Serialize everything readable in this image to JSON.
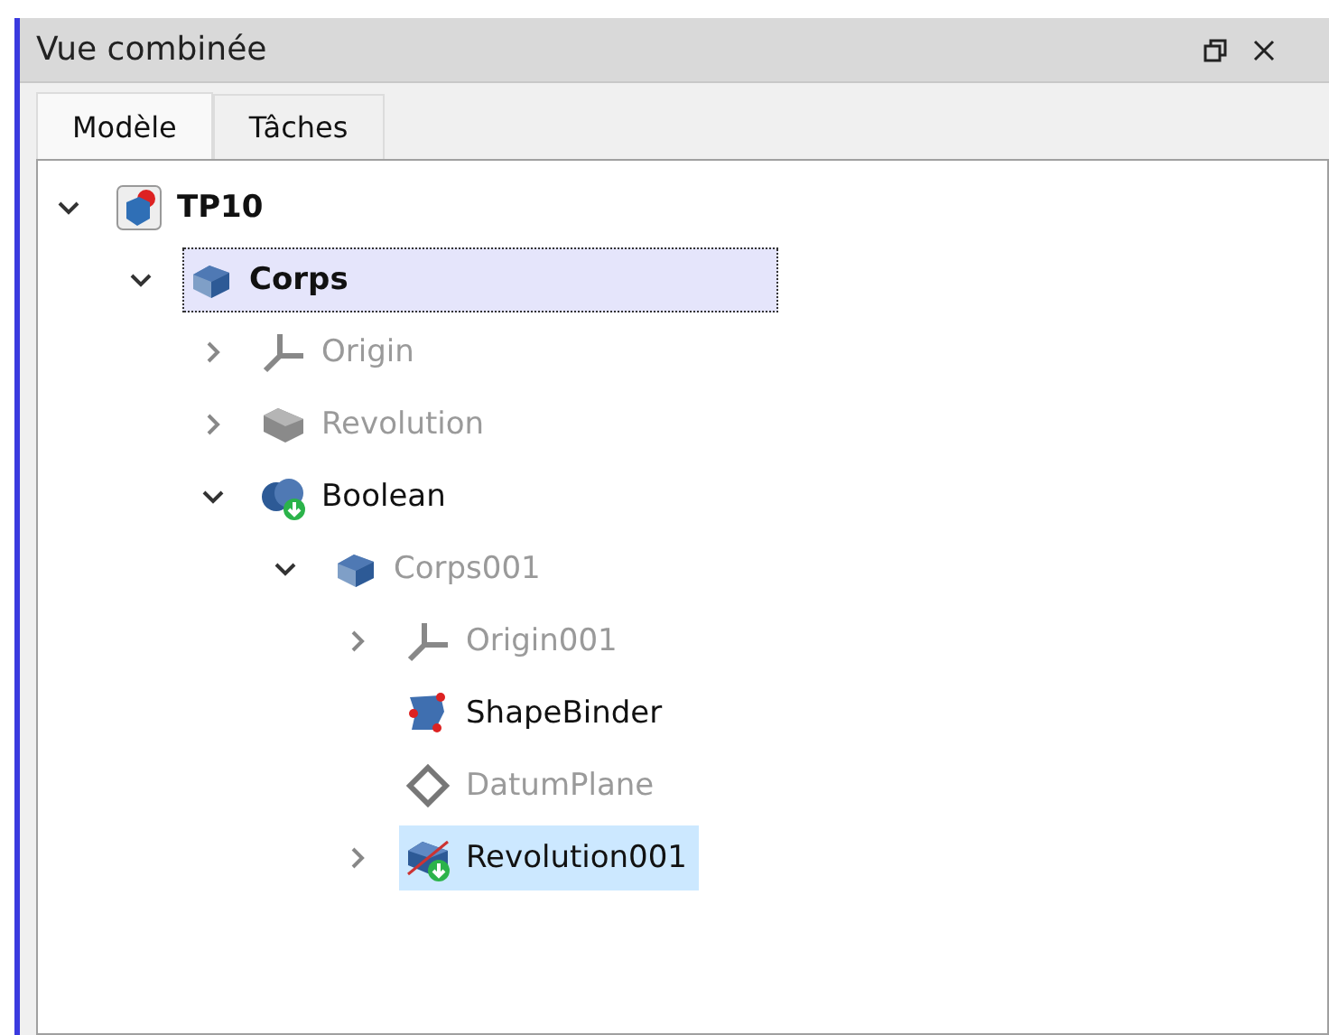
{
  "panel": {
    "title": "Vue combinée"
  },
  "tabs": [
    {
      "label": "Modèle",
      "selected": true
    },
    {
      "label": "Tâches",
      "selected": false
    }
  ],
  "tree": [
    {
      "label": "TP10",
      "kind": "document",
      "bold": true,
      "dimmed": false,
      "active": false,
      "selected": false,
      "expanded": true,
      "children": [
        {
          "label": "Corps",
          "kind": "body",
          "bold": true,
          "dimmed": false,
          "active": true,
          "selected": false,
          "expanded": true,
          "children": [
            {
              "label": "Origin",
              "kind": "origin",
              "bold": false,
              "dimmed": true,
              "active": false,
              "selected": false,
              "expanded": false
            },
            {
              "label": "Revolution",
              "kind": "revolution",
              "bold": false,
              "dimmed": true,
              "active": false,
              "selected": false,
              "expanded": false
            },
            {
              "label": "Boolean",
              "kind": "boolean",
              "bold": false,
              "dimmed": false,
              "active": false,
              "selected": false,
              "expanded": true,
              "children": [
                {
                  "label": "Corps001",
                  "kind": "body",
                  "bold": false,
                  "dimmed": true,
                  "active": false,
                  "selected": false,
                  "expanded": true,
                  "children": [
                    {
                      "label": "Origin001",
                      "kind": "origin",
                      "bold": false,
                      "dimmed": true,
                      "active": false,
                      "selected": false,
                      "expanded": false
                    },
                    {
                      "label": "ShapeBinder",
                      "kind": "binder",
                      "bold": false,
                      "dimmed": false,
                      "active": false,
                      "selected": false
                    },
                    {
                      "label": "DatumPlane",
                      "kind": "plane",
                      "bold": false,
                      "dimmed": true,
                      "active": false,
                      "selected": false
                    },
                    {
                      "label": "Revolution001",
                      "kind": "revolution-add",
                      "bold": false,
                      "dimmed": false,
                      "active": false,
                      "selected": true,
                      "expanded": false
                    }
                  ]
                }
              ]
            }
          ]
        }
      ]
    }
  ]
}
